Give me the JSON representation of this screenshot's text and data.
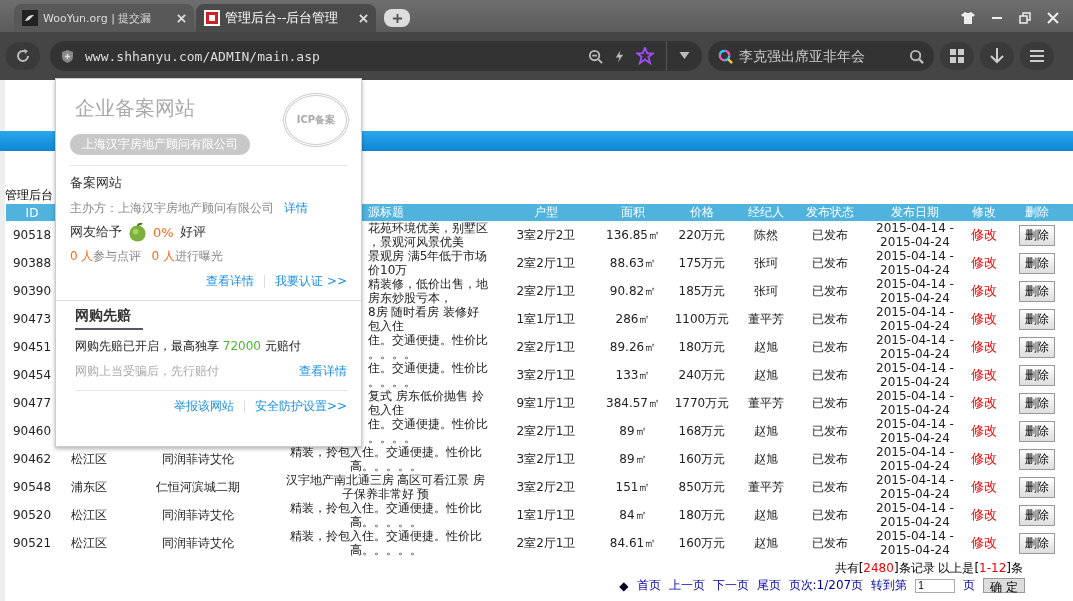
{
  "browser": {
    "tabs": [
      {
        "title": "WooYun.org | 提交漏",
        "selected": false
      },
      {
        "title": "管理后台--后台管理",
        "selected": true
      }
    ],
    "address": "www.shhanyu.com/ADMIN/main.asp",
    "search": {
      "placeholder": "李克强出席亚非年会"
    }
  },
  "page": {
    "heading": "管理后台",
    "columns": [
      "ID",
      "源标题",
      "户型",
      "面积",
      "价格",
      "经纪人",
      "发布状态",
      "发布日期",
      "修改",
      "删除"
    ],
    "rows": [
      {
        "id": "90518",
        "title": [
          "花苑环境优美，别墅区",
          "，景观河风景优美"
        ],
        "layout": "3室2厅2卫",
        "area": "136.85㎡",
        "price": "220万元",
        "agent": "陈然",
        "status": "已发布",
        "date": [
          "2015-04-14 -",
          "2015-04-24"
        ],
        "edit": "修改",
        "delete": "删除"
      },
      {
        "id": "90388",
        "title": [
          "景观房 满5年低于市场",
          "价10万"
        ],
        "layout": "2室2厅1卫",
        "area": "88.63㎡",
        "price": "175万元",
        "agent": "张珂",
        "status": "已发布",
        "date": [
          "2015-04-14 -",
          "2015-04-24"
        ],
        "edit": "修改",
        "delete": "删除"
      },
      {
        "id": "90390",
        "title": [
          "精装修，低价出售，地",
          "房东炒股亏本，"
        ],
        "layout": "2室2厅1卫",
        "area": "90.82㎡",
        "price": "185万元",
        "agent": "张珂",
        "status": "已发布",
        "date": [
          "2015-04-14 -",
          "2015-04-24"
        ],
        "edit": "修改",
        "delete": "删除"
      },
      {
        "id": "90473",
        "title": [
          "8房 随时看房 装修好",
          "包入住"
        ],
        "layout": "1室1厅1卫",
        "area": "286㎡",
        "price": "1100万元",
        "agent": "董平芳",
        "status": "已发布",
        "date": [
          "2015-04-14 -",
          "2015-04-24"
        ],
        "edit": "修改",
        "delete": "删除"
      },
      {
        "id": "90451",
        "title": [
          "住。交通便捷。性价比",
          "。。。。"
        ],
        "layout": "2室2厅1卫",
        "area": "89.26㎡",
        "price": "180万元",
        "agent": "赵旭",
        "status": "已发布",
        "date": [
          "2015-04-14 -",
          "2015-04-24"
        ],
        "edit": "修改",
        "delete": "删除"
      },
      {
        "id": "90454",
        "title": [
          "住。交通便捷。性价比",
          "。。。。"
        ],
        "layout": "3室2厅1卫",
        "area": "133㎡",
        "price": "240万元",
        "agent": "赵旭",
        "status": "已发布",
        "date": [
          "2015-04-14 -",
          "2015-04-24"
        ],
        "edit": "修改",
        "delete": "删除"
      },
      {
        "id": "90477",
        "title": [
          "复式 房东低价抛售 拎",
          "包入住"
        ],
        "layout": "9室1厅1卫",
        "area": "384.57㎡",
        "price": "1770万元",
        "agent": "董平芳",
        "status": "已发布",
        "date": [
          "2015-04-14 -",
          "2015-04-24"
        ],
        "edit": "修改",
        "delete": "删除"
      },
      {
        "id": "90460",
        "title": [
          "住。交通便捷。性价比",
          "。。。。"
        ],
        "layout": "2室2厅1卫",
        "area": "89㎡",
        "price": "168万元",
        "agent": "赵旭",
        "status": "已发布",
        "date": [
          "2015-04-14 -",
          "2015-04-24"
        ],
        "edit": "修改",
        "delete": "删除"
      },
      {
        "id": "90462",
        "region": "松江区",
        "community": "同润菲诗艾伦",
        "title": [
          "精装，拎包入住。交通便捷。性价比",
          "高。。。。。"
        ],
        "layout": "3室2厅1卫",
        "area": "89㎡",
        "price": "160万元",
        "agent": "赵旭",
        "status": "已发布",
        "date": [
          "2015-04-14 -",
          "2015-04-24"
        ],
        "edit": "修改",
        "delete": "删除"
      },
      {
        "id": "90548",
        "region": "浦东区",
        "community": "仁恒河滨城二期",
        "title": [
          "汉宇地产南北通三房 高区可看江景 房",
          "子保养非常好 预"
        ],
        "layout": "3室2厅2卫",
        "area": "151㎡",
        "price": "850万元",
        "agent": "董平芳",
        "status": "已发布",
        "date": [
          "2015-04-14 -",
          "2015-04-24"
        ],
        "edit": "修改",
        "delete": "删除"
      },
      {
        "id": "90520",
        "region": "松江区",
        "community": "同润菲诗艾伦",
        "title": [
          "精装，拎包入住。交通便捷。性价比",
          "高。。。。。"
        ],
        "layout": "1室1厅1卫",
        "area": "84㎡",
        "price": "180万元",
        "agent": "赵旭",
        "status": "已发布",
        "date": [
          "2015-04-14 -",
          "2015-04-24"
        ],
        "edit": "修改",
        "delete": "删除"
      },
      {
        "id": "90521",
        "region": "松江区",
        "community": "同润菲诗艾伦",
        "title": [
          "精装，拎包入住。交通便捷。性价比",
          "高。。。。。"
        ],
        "layout": "2室2厅1卫",
        "area": "84.61㎡",
        "price": "160万元",
        "agent": "赵旭",
        "status": "已发布",
        "date": [
          "2015-04-14 -",
          "2015-04-24"
        ],
        "edit": "修改",
        "delete": "删除"
      }
    ],
    "summary": {
      "prefix": "共有[",
      "total": "2480",
      "middle": "]条记录 以上是[",
      "range": "1-12",
      "suffix": "]条"
    },
    "pager": {
      "marker": "◆",
      "links": [
        "首页",
        "上一页",
        "下一页",
        "尾页"
      ],
      "page_info": "页次:1/207页",
      "goto_label": "转到第",
      "goto_value": "1",
      "goto_suffix": "页",
      "confirm": "确 定"
    }
  },
  "popup": {
    "title": "企业备案网站",
    "stamp": "ICP备案",
    "company": "上海汉宇房地产顾问有限公司",
    "section": "备案网站",
    "sponsor": "主办方：上海汉宇房地产顾问有限公司",
    "sponsor_link": "详情",
    "rating_label": "网友给予",
    "rating_value": "0%",
    "rating_suffix": "好评",
    "stats": [
      {
        "count": "0 人",
        "label": "参与点评"
      },
      {
        "count": "0 人",
        "label": "进行曝光"
      }
    ],
    "links": [
      "查看详情",
      "我要认证 >>"
    ],
    "guarantee": {
      "heading": "网购先赔",
      "text_before": "网购先赔已开启，最高独享 ",
      "amount": "72000",
      "text_after": " 元赔付",
      "note": "网购上当受骗后，先行赔付",
      "link": "查看详情"
    },
    "footer_links": [
      "举报该网站",
      "安全防护设置>>"
    ]
  }
}
